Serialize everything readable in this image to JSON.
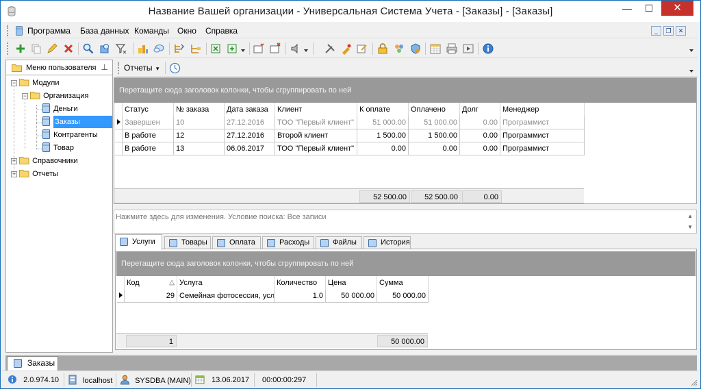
{
  "window": {
    "title": "Название Вашей организации - Универсальная Система Учета - [Заказы] - [Заказы]",
    "minimize_glyph": "—",
    "maximize_glyph": "☐",
    "close_glyph": "✕"
  },
  "menu": {
    "items": [
      {
        "label": "Программа"
      },
      {
        "label": "База данных"
      },
      {
        "label": "Команды"
      },
      {
        "label": "Окно"
      },
      {
        "label": "Справка"
      }
    ],
    "mdi_min": "_",
    "mdi_restore": "❐",
    "mdi_close": "✕"
  },
  "toolbar": {
    "icons": [
      "add-icon",
      "copy-icon",
      "edit-icon",
      "delete-icon",
      "search-icon",
      "find-next-icon",
      "filter-icon",
      "hierarchy-icon",
      "comment-icon",
      "sort-icon",
      "sort-tree-icon",
      "export-excel-icon",
      "export-dropdown-icon",
      "new-window-icon",
      "close-window-icon",
      "audio-icon",
      "tools-icon",
      "paint-icon",
      "note-edit-icon",
      "lock-icon",
      "users-icon",
      "security-icon",
      "calendar-grid-icon",
      "print-icon",
      "media-icon",
      "info-icon"
    ]
  },
  "left_panel": {
    "header": "Меню пользователя",
    "pin_glyph": "⊥",
    "tree": {
      "modules": "Модули",
      "organization": "Организация",
      "money": "Деньги",
      "orders": "Заказы",
      "contractors": "Контрагенты",
      "goods": "Товар",
      "references": "Справочники",
      "reports": "Отчеты",
      "expanded_glyph": "−",
      "collapsed_glyph": "+"
    }
  },
  "doc_toolbar": {
    "reports_label": "Отчеты",
    "dropdown_glyph": "▾"
  },
  "orders": {
    "group_hint": "Перетащите сюда заголовок колонки, чтобы сгруппировать по ней",
    "columns": [
      "Статус",
      "№ заказа",
      "Дата заказа",
      "Клиент",
      "К оплате",
      "Оплачено",
      "Долг",
      "Менеджер"
    ],
    "rows": [
      {
        "status": "Завершен",
        "number": "10",
        "date": "27.12.2016",
        "client": "ТОО \"Первый клиент\"",
        "to_pay": "51 000.00",
        "paid": "51 000.00",
        "debt": "0.00",
        "manager": "Программист"
      },
      {
        "status": "В работе",
        "number": "12",
        "date": "27.12.2016",
        "client": "Второй клиент",
        "to_pay": "1 500.00",
        "paid": "1 500.00",
        "debt": "0.00",
        "manager": "Программист"
      },
      {
        "status": "В работе",
        "number": "13",
        "date": "06.06.2017",
        "client": "ТОО \"Первый клиент\"",
        "to_pay": "0.00",
        "paid": "0.00",
        "debt": "0.00",
        "manager": "Программист"
      }
    ],
    "totals": {
      "to_pay": "52 500.00",
      "paid": "52 500.00",
      "debt": "0.00"
    }
  },
  "filter": {
    "text": "Нажмите здесь для изменения. Условие поиска: Все записи",
    "scroll_up": "▲",
    "scroll_down": "▼"
  },
  "detail_tabs": [
    {
      "label": "Услуги"
    },
    {
      "label": "Товары"
    },
    {
      "label": "Оплата"
    },
    {
      "label": "Расходы"
    },
    {
      "label": "Файлы"
    },
    {
      "label": "История"
    }
  ],
  "services": {
    "group_hint": "Перетащите сюда заголовок колонки, чтобы сгруппировать по ней",
    "columns": [
      "Код",
      "Услуга",
      "Количество",
      "Цена",
      "Сумма"
    ],
    "sort_glyph": "△",
    "rows": [
      {
        "code": "29",
        "service": "Семейная фотосессия, усл",
        "quantity": "1.0",
        "price": "50 000.00",
        "sum": "50 000.00"
      }
    ],
    "totals": {
      "count": "1",
      "sum": "50 000.00"
    }
  },
  "task_tab": {
    "label": "Заказы"
  },
  "status": {
    "version": "2.0.974.10",
    "server": "localhost",
    "user": "SYSDBA (MAIN)",
    "date": "13.06.2017",
    "timer": "00:00:00:297"
  },
  "colors": {
    "accent": "#1a6fb5",
    "selection": "#3399ff",
    "group_bar": "#999999",
    "close_button": "#c7312b"
  }
}
